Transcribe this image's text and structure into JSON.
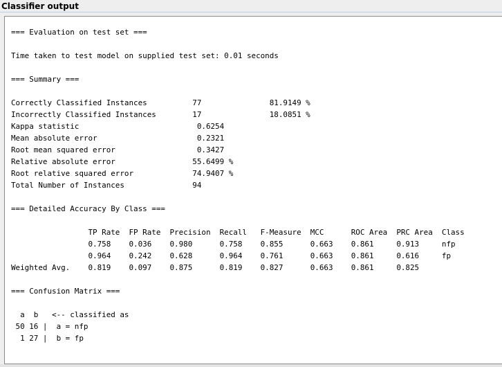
{
  "panel": {
    "title": "Classifier output"
  },
  "output": {
    "lines": [
      "=== Evaluation on test set ===",
      "",
      "Time taken to test model on supplied test set: 0.01 seconds",
      "",
      "=== Summary ===",
      "",
      "Correctly Classified Instances          77               81.9149 %",
      "Incorrectly Classified Instances        17               18.0851 %",
      "Kappa statistic                          0.6254",
      "Mean absolute error                      0.2321",
      "Root mean squared error                  0.3427",
      "Relative absolute error                 55.6499 %",
      "Root relative squared error             74.9407 %",
      "Total Number of Instances               94",
      "",
      "=== Detailed Accuracy By Class ===",
      "",
      "                 TP Rate  FP Rate  Precision  Recall   F-Measure  MCC      ROC Area  PRC Area  Class",
      "                 0.758    0.036    0.980      0.758    0.855      0.663    0.861     0.913     nfp",
      "                 0.964    0.242    0.628      0.964    0.761      0.663    0.861     0.616     fp",
      "Weighted Avg.    0.819    0.097    0.875      0.819    0.827      0.663    0.861     0.825",
      "",
      "=== Confusion Matrix ===",
      "",
      "  a  b   <-- classified as",
      " 50 16 |  a = nfp",
      "  1 27 |  b = fp"
    ]
  }
}
